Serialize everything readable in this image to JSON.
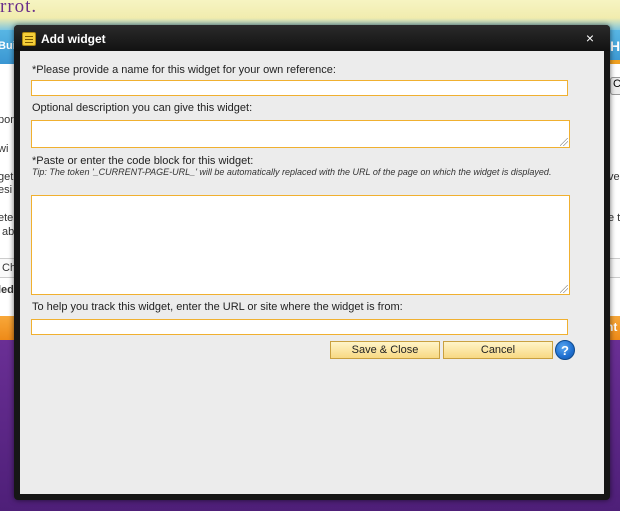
{
  "background": {
    "logo": "rrot.",
    "nav_left": "Buil",
    "nav_right": "H",
    "right_button": "C",
    "fragments": [
      "port",
      "wi",
      "get",
      "esi",
      "ete",
      "ab",
      "Ch",
      "led",
      "ver",
      "e t"
    ],
    "orange_bar_right": "nt"
  },
  "dialog": {
    "title": "Add widget",
    "close": "×",
    "name_label": "*Please provide a name for this widget for your own reference:",
    "name_value": "",
    "description_label": "Optional description you can give this widget:",
    "description_value": "",
    "code_label": "*Paste or enter the code block for this widget:",
    "code_tip": "Tip: The token '_CURRENT-PAGE-URL_' will be automatically replaced with the URL of the page on which the widget is displayed.",
    "code_value": "",
    "url_label": "To help you track this widget, enter the URL or site where the widget is from:",
    "url_value": "",
    "save_button": "Save & Close",
    "cancel_button": "Cancel",
    "help_button": "?"
  },
  "colors": {
    "accent_orange": "#f0b030",
    "help_blue": "#1f6fd0",
    "title_bar": "#161616"
  }
}
